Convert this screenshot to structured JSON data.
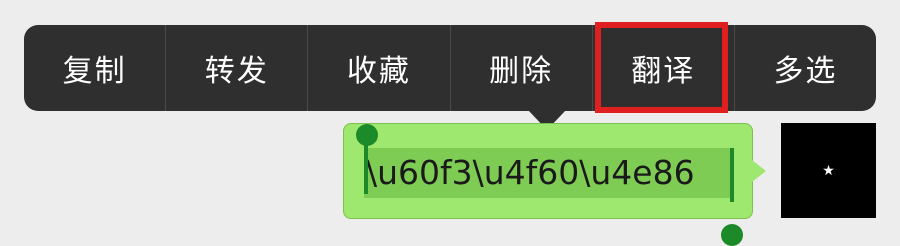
{
  "context_menu": {
    "items": [
      {
        "label": "复制",
        "name": "menu-item-copy"
      },
      {
        "label": "转发",
        "name": "menu-item-forward"
      },
      {
        "label": "收藏",
        "name": "menu-item-favorite"
      },
      {
        "label": "删除",
        "name": "menu-item-delete"
      },
      {
        "label": "翻译",
        "name": "menu-item-translate",
        "highlighted": true
      },
      {
        "label": "多选",
        "name": "menu-item-multi-select"
      }
    ],
    "highlight_color": "#e02020",
    "background_color": "#2f2f2f"
  },
  "message": {
    "text": "\\u60f3\\u4f60\\u4e86",
    "bubble_color": "#9fe870",
    "selection_color": "#7fcc55",
    "handle_color": "#1c8a28"
  },
  "avatar": {
    "icon": "star-icon",
    "glyph": "★"
  }
}
